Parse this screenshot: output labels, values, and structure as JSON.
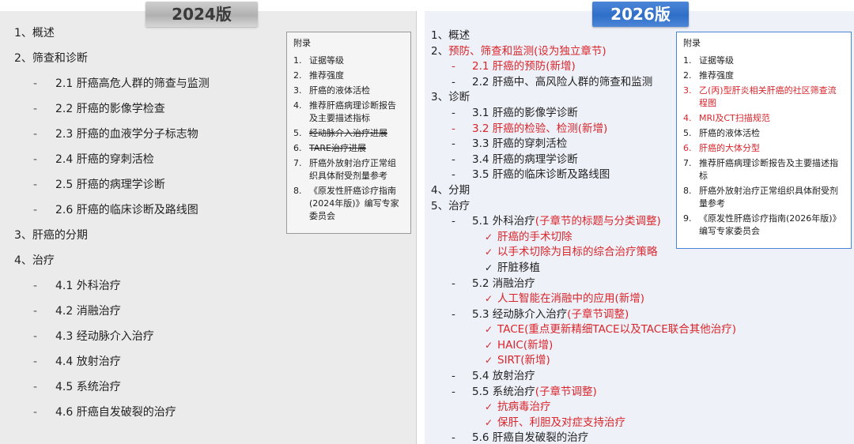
{
  "left": {
    "version": "2024版",
    "toc": [
      {
        "text": "1、概述",
        "level": 0
      },
      {
        "text": "2、筛查和诊断",
        "level": 0
      },
      {
        "text": "2.1 肝癌高危人群的筛查与监测",
        "level": 1
      },
      {
        "text": "2.2 肝癌的影像学检查",
        "level": 1
      },
      {
        "text": "2.3 肝癌的血液学分子标志物",
        "level": 1
      },
      {
        "text": "2.4 肝癌的穿刺活检",
        "level": 1
      },
      {
        "text": "2.5 肝癌的病理学诊断",
        "level": 1
      },
      {
        "text": "2.6 肝癌的临床诊断及路线图",
        "level": 1
      },
      {
        "text": "3、肝癌的分期",
        "level": 0
      },
      {
        "text": "4、治疗",
        "level": 0
      },
      {
        "text": "4.1 外科治疗",
        "level": 1
      },
      {
        "text": "4.2 消融治疗",
        "level": 1
      },
      {
        "text": "4.3 经动脉介入治疗",
        "level": 1
      },
      {
        "text": "4.4 放射治疗",
        "level": 1
      },
      {
        "text": "4.5 系统治疗",
        "level": 1
      },
      {
        "text": "4.6 肝癌自发破裂的治疗",
        "level": 1
      }
    ],
    "appendix": {
      "title": "附录",
      "items": [
        {
          "num": "1.",
          "text": "证据等级"
        },
        {
          "num": "2.",
          "text": "推荐强度"
        },
        {
          "num": "3.",
          "text": "肝癌的液体活检"
        },
        {
          "num": "4.",
          "text": "推荐肝癌病理诊断报告及主要描述指标"
        },
        {
          "num": "5.",
          "text": "经动脉介入治疗进展"
        },
        {
          "num": "6.",
          "text": "TARE治疗进展"
        },
        {
          "num": "7.",
          "text": "肝癌外放射治疗正常组织具体耐受剂量参考"
        },
        {
          "num": "8.",
          "text": "《原发性肝癌诊疗指南(2024年版)》编写专家委员会"
        }
      ]
    }
  },
  "right": {
    "version": "2026版",
    "toc": [
      {
        "text": "1、概述",
        "level": 0
      },
      {
        "text": "2、",
        "red": "预防、筛查和监测(设为独立章节)",
        "level": 0
      },
      {
        "text": "",
        "red": "2.1 肝癌的预防(新增)",
        "level": 1
      },
      {
        "text": "2.2 肝癌中、高风险人群的筛查和监测",
        "level": 1
      },
      {
        "text": "3、诊断",
        "level": 0
      },
      {
        "text": "3.1 肝癌的影像学诊断",
        "level": 1
      },
      {
        "text": "",
        "red": "3.2 肝癌的检验、检测(新增)",
        "level": 1
      },
      {
        "text": "3.3 肝癌的穿刺活检",
        "level": 1
      },
      {
        "text": "3.4 肝癌的病理学诊断",
        "level": 1
      },
      {
        "text": "3.5 肝癌的临床诊断及路线图",
        "level": 1
      },
      {
        "text": "4、分期",
        "level": 0
      },
      {
        "text": "5、治疗",
        "level": 0
      },
      {
        "text": "5.1 外科治疗",
        "red": "(子章节的标题与分类调整)",
        "level": 1
      },
      {
        "text": "",
        "red": "肝癌的手术切除",
        "level": 2
      },
      {
        "text": "",
        "red": "以手术切除为目标的综合治疗策略",
        "level": 2
      },
      {
        "text": "肝脏移植",
        "level": 2
      },
      {
        "text": "5.2 消融治疗",
        "level": 1
      },
      {
        "text": "",
        "red": "人工智能在消融中的应用(新增)",
        "level": 2
      },
      {
        "text": "5.3 经动脉介入治疗",
        "red": "(子章节调整)",
        "level": 1
      },
      {
        "text": "",
        "red": "TACE(重点更新精细TACE以及TACE联合其他治疗)",
        "level": 2
      },
      {
        "text": "",
        "red": "HAIC(新增)",
        "level": 2
      },
      {
        "text": "",
        "red": "SIRT(新增)",
        "level": 2
      },
      {
        "text": "5.4 放射治疗",
        "level": 1
      },
      {
        "text": "5.5 系统治疗",
        "red": "(子章节调整)",
        "level": 1
      },
      {
        "text": "",
        "red": "抗病毒治疗",
        "level": 2
      },
      {
        "text": "",
        "red": "保肝、利胆及对症支持治疗",
        "level": 2
      },
      {
        "text": "5.6 肝癌自发破裂的治疗",
        "level": 1
      }
    ],
    "appendix": {
      "title": "附录",
      "items": [
        {
          "num": "1.",
          "text": "证据等级"
        },
        {
          "num": "2.",
          "text": "推荐强度"
        },
        {
          "num": "3.",
          "text": "乙(丙)型肝炎相关肝癌的社区筛查流程图",
          "red": true
        },
        {
          "num": "4.",
          "text": "MRI及CT扫描规范",
          "red": true
        },
        {
          "num": "5.",
          "text": "肝癌的液体活检"
        },
        {
          "num": "6.",
          "text": "肝癌的大体分型",
          "red": true
        },
        {
          "num": "7.",
          "text": "推荐肝癌病理诊断报告及主要描述指标"
        },
        {
          "num": "8.",
          "text": "肝癌外放射治疗正常组织具体耐受剂量参考"
        },
        {
          "num": "9.",
          "text": "《原发性肝癌诊疗指南(2026年版)》编写专家委员会"
        }
      ]
    }
  },
  "glyphs": {
    "dash": "-",
    "tick": "✓"
  },
  "colors": {
    "accent_blue": "#2f6fc8",
    "new_red": "#d9262c",
    "panel_gray": "#ebebeb"
  }
}
